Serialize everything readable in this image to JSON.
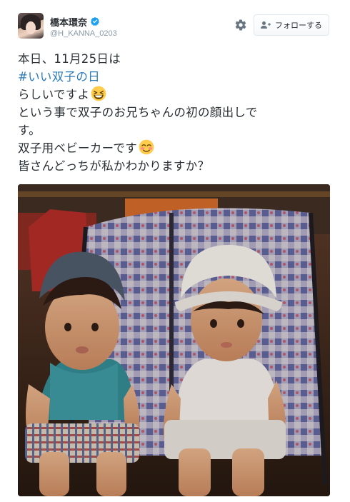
{
  "user": {
    "display_name": "橋本環奈",
    "handle": "@H_KANNA_0203",
    "verified": true
  },
  "actions": {
    "follow_label": "フォローする",
    "settings_icon": "gear-icon"
  },
  "tweet": {
    "line1": "本日、11月25日は",
    "hashtag": "#いい双子の日",
    "line3": "らしいですよ",
    "line4": "という事で双子のお兄ちゃんの初の顔出しで",
    "line5": "す。",
    "line6": "双子用ベビーカーです",
    "line7": "皆さんどっちが私かわかりますか？",
    "emoji1": "laughing-face-emoji",
    "emoji2": "smiling-blush-face-emoji"
  },
  "colors": {
    "text": "#292f33",
    "hashtag": "#2b7bb9",
    "verified": "#1da1f2",
    "muted": "#8899a6"
  }
}
